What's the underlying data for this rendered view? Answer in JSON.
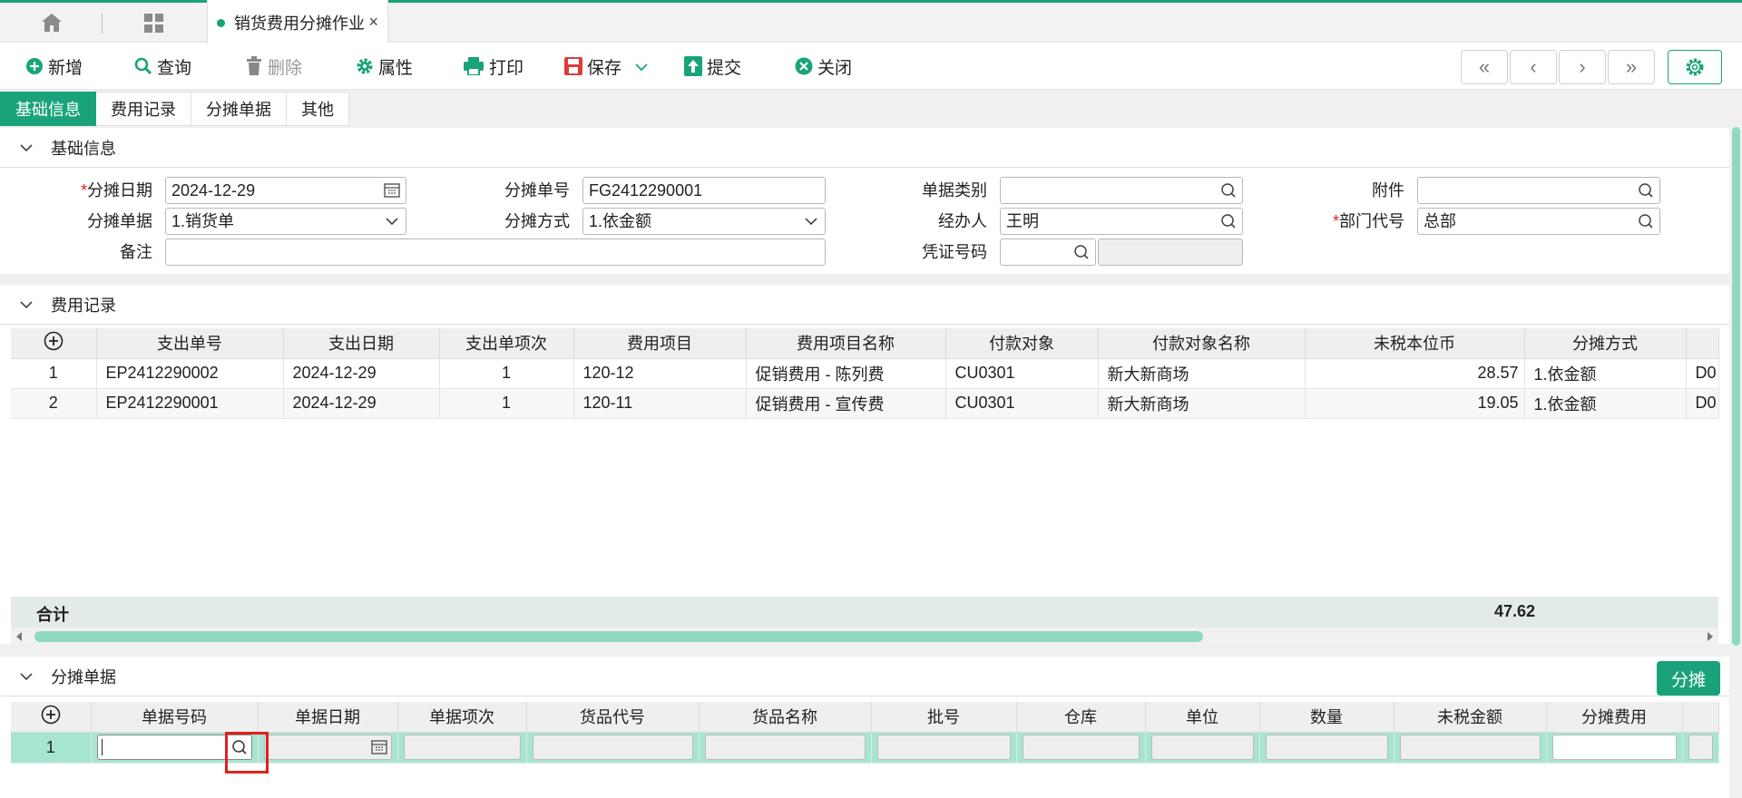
{
  "tabs": {
    "active_title": "销货费用分摊作业",
    "close": "×"
  },
  "toolbar": {
    "add": "新增",
    "query": "查询",
    "delete": "删除",
    "props": "属性",
    "print": "打印",
    "save": "保存",
    "submit": "提交",
    "close": "关闭",
    "nav": [
      "«",
      "‹",
      "›",
      "»"
    ]
  },
  "section_tabs": [
    "基础信息",
    "费用记录",
    "分摊单据",
    "其他"
  ],
  "basic": {
    "title": "基础信息",
    "alloc_date_label": "分摊日期",
    "alloc_date": "2024-12-29",
    "alloc_no_label": "分摊单号",
    "alloc_no": "FG2412290001",
    "doc_type_label": "单据类别",
    "doc_type": "",
    "attach_label": "附件",
    "attach": "",
    "alloc_doc_label": "分摊单据",
    "alloc_doc": "1.销货单",
    "alloc_method_label": "分摊方式",
    "alloc_method": "1.依金额",
    "handler_label": "经办人",
    "handler": "王明",
    "dept_label": "部门代号",
    "dept": "总部",
    "remark_label": "备注",
    "remark": "",
    "voucher_label": "凭证号码",
    "voucher": ""
  },
  "expense": {
    "title": "费用记录",
    "columns": [
      "支出单号",
      "支出日期",
      "支出单项次",
      "费用项目",
      "费用项目名称",
      "付款对象",
      "付款对象名称",
      "未税本位币",
      "分摊方式",
      ""
    ],
    "rows": [
      [
        "1",
        "EP2412290002",
        "2024-12-29",
        "1",
        "120-12",
        "促销费用 - 陈列费",
        "CU0301",
        "新大新商场",
        "28.57",
        "1.依金额",
        "D0"
      ],
      [
        "2",
        "EP2412290001",
        "2024-12-29",
        "1",
        "120-11",
        "促销费用 - 宣传费",
        "CU0301",
        "新大新商场",
        "19.05",
        "1.依金额",
        "D0"
      ]
    ],
    "sum_label": "合计",
    "sum_value": "47.62"
  },
  "alloc_docs": {
    "title": "分摊单据",
    "button": "分摊",
    "columns": [
      "单据号码",
      "单据日期",
      "单据项次",
      "货品代号",
      "货品名称",
      "批号",
      "仓库",
      "单位",
      "数量",
      "未税金额",
      "分摊费用"
    ],
    "row_no": "1"
  },
  "colors": {
    "accent": "#1aa37a",
    "required": "#e02020"
  }
}
